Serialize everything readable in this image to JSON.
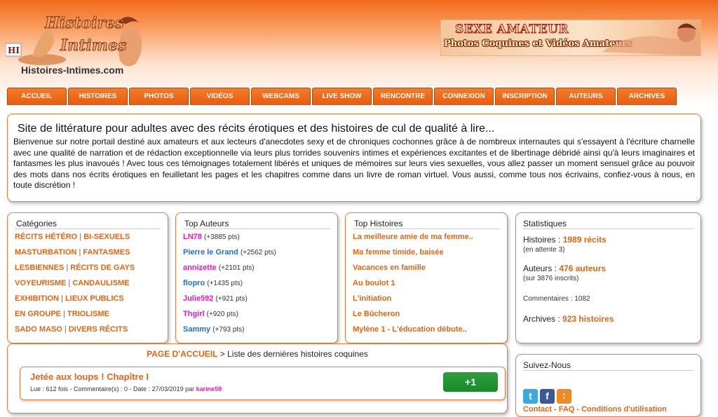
{
  "header": {
    "logo_line1": "Histoires",
    "logo_line2": "Intimes",
    "logo_badge": "HI",
    "site_name": "Histoires-Intimes.com",
    "ad_title": "SEXE AMATEUR",
    "ad_subtitle": "Photos Coquines et Vidéos Amateurs"
  },
  "nav": [
    "ACCUEIL",
    "HISTOIRES",
    "PHOTOS",
    "VIDÉOS",
    "WEBCAMS",
    "LIVE SHOW",
    "RENCONTRE",
    "CONNEXION",
    "INSCRIPTION",
    "AUTEURS",
    "ARCHIVES"
  ],
  "intro": {
    "title": "Site de littérature pour adultes avec des récits érotiques et des histoires de cul de qualité à lire...",
    "text": "Bienvenue sur notre portail destiné aux amateurs et aux lecteurs d'anecdotes sexy et de chroniques cochonnes grâce à de nombreux internautes qui s'essayent à l'écriture charnelle avec une qualité de narration et de rédaction exceptionnelle via leurs plus torrides souvenirs intimes et expériences excitantes et de libertinage débridé ainsi qu'à leurs imaginaires et fantasmes les plus inavoués ! Avec tous ces témoignages totalement libérés et uniques de mémoires sur leurs vies sexuelles, vous allez passer un moment sensuel grâce au pouvoir des mots dans nos écrits érotiques en feuilletant les pages et les chapitres comme dans un livre de roman virtuel. Vous aussi, comme tous nos écrivains, confiez-vous à nous, en toute discrétion !"
  },
  "categories": {
    "title": "Catégories",
    "rows": [
      [
        "RÉCITS HÉTÉRO",
        "BI-SEXUELS"
      ],
      [
        "MASTURBATION",
        "FANTASMES"
      ],
      [
        "LESBIENNES",
        "RÉCITS DE GAYS"
      ],
      [
        "VOYEURISME",
        "CANDAULISME"
      ],
      [
        "EXHIBITION",
        "LIEUX PUBLICS"
      ],
      [
        "EN GROUPE",
        "TRIOLISME"
      ],
      [
        "SADO MASO",
        "DIVERS RÉCITS"
      ]
    ]
  },
  "top_authors": {
    "title": "Top Auteurs",
    "items": [
      {
        "name": "LN78",
        "pts": "(+3885 pts)",
        "color": "#e817c4"
      },
      {
        "name": "Pierre le Grand",
        "pts": "(+2562 pts)",
        "color": "#1e6fd9"
      },
      {
        "name": "annizette",
        "pts": "(+2101 pts)",
        "color": "#e817c4"
      },
      {
        "name": "flopro",
        "pts": "(+1435 pts)",
        "color": "#1e6fd9"
      },
      {
        "name": "Julie592",
        "pts": "(+921 pts)",
        "color": "#e817c4"
      },
      {
        "name": "Thgirl",
        "pts": "(+920 pts)",
        "color": "#e817c4"
      },
      {
        "name": "Sammy",
        "pts": "(+793 pts)",
        "color": "#1e6fd9"
      }
    ]
  },
  "top_stories": {
    "title": "Top Histoires",
    "items": [
      "La meilleure amie de ma femme..",
      "Ma femme timide, baisée",
      "Vacances en famille",
      "Au boulot 1",
      "L'initiation",
      "Le Bûcheron",
      "Mylène 1 - L'éducation débute.."
    ]
  },
  "stats": {
    "title": "Statistiques",
    "histoires_label": "Histoires : ",
    "histoires_val": "1989 récits",
    "histoires_note": "(en attente 3)",
    "auteurs_label": "Auteurs : ",
    "auteurs_val": "476 auteurs",
    "auteurs_note": "(sur 3876 inscrits)",
    "commentaires": "Commentaires : 1082",
    "archives_label": "Archives : ",
    "archives_val": "923 histoires"
  },
  "listing": {
    "breadcrumb_link": "PAGE D'ACCUEIL",
    "breadcrumb_rest": " > Liste des dernières histoires coquines",
    "post": {
      "title": "Jetée aux loups ! Chapître I",
      "meta": "Lue : 612 fois - Commentaire(s) : 0 - Date : 27/03/2019 par ",
      "author": "karine59",
      "vote": "+1"
    }
  },
  "follow": {
    "title": "Suivez-Nous",
    "links": "Contact - FAQ - Conditions d'utilisation"
  },
  "colors": {
    "accent": "#e46413",
    "nav": "#f0670f",
    "vote": "#1f9a32"
  }
}
